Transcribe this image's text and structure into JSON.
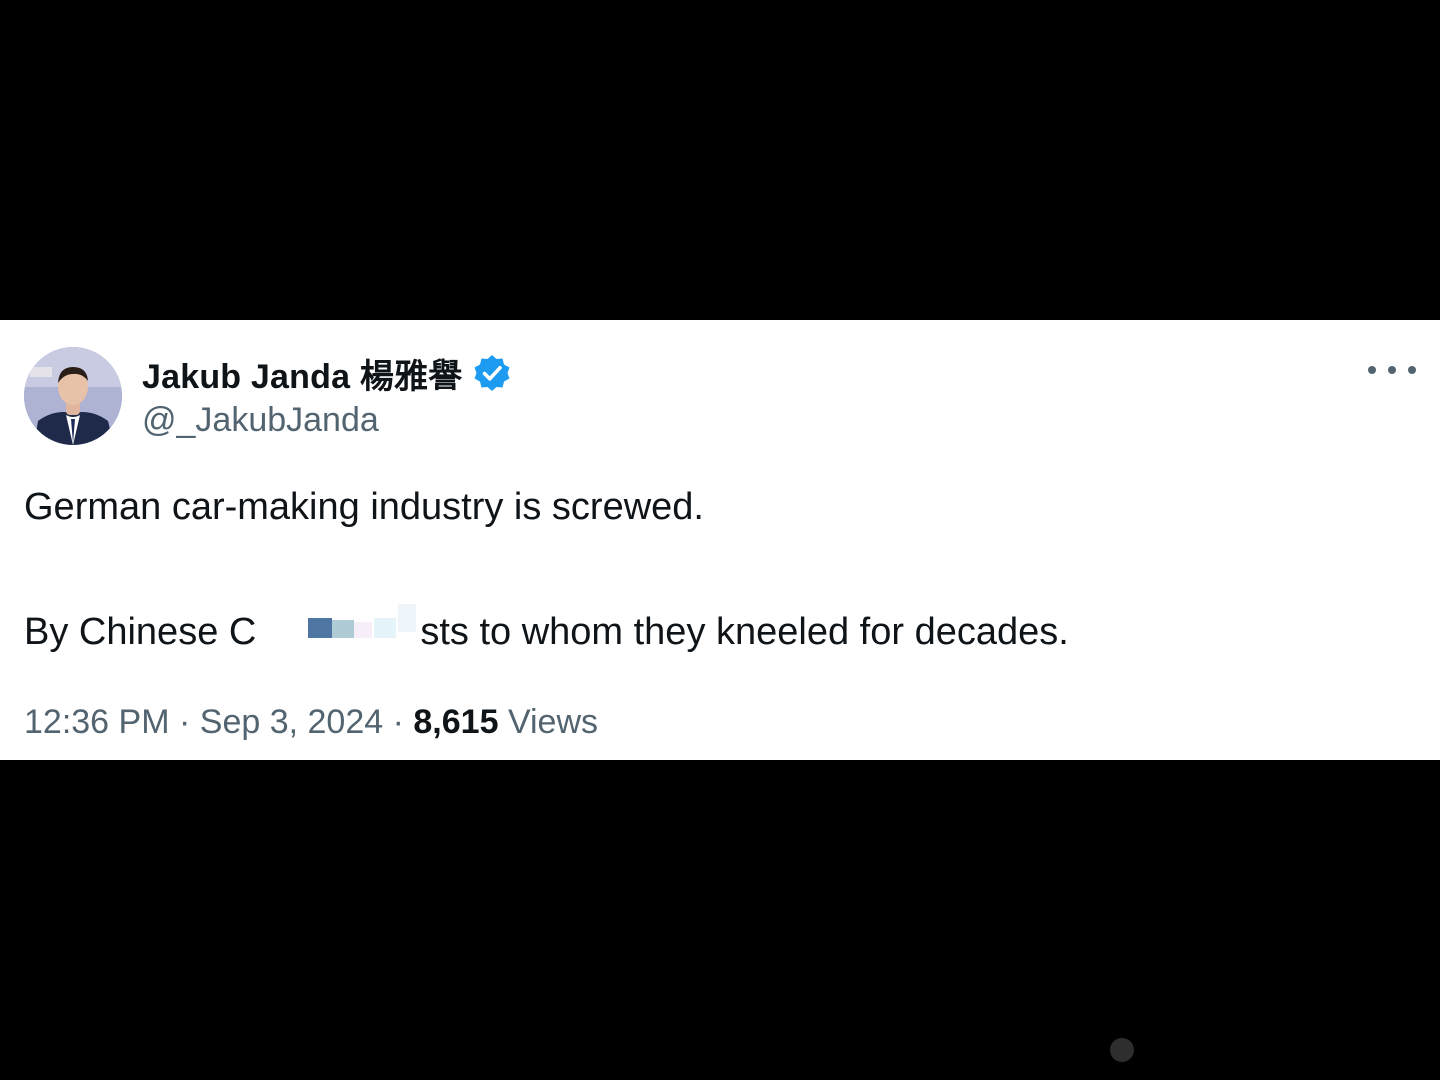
{
  "tweet": {
    "display_name": "Jakub Janda 楊雅譽",
    "handle": "@_JakubJanda",
    "text_line1": "German car-making industry is screwed.",
    "text_line2_start": "By Chinese C",
    "text_line2_end": "sts to whom they kneeled for decades.",
    "time": "12:36 PM",
    "separator": "·",
    "date": "Sep 3, 2024",
    "views_count": "8,615",
    "views_label": "Views"
  },
  "icons": {
    "verified": "verified-badge-icon",
    "more": "more-options-icon",
    "avatar": "profile-avatar"
  },
  "colors": {
    "background": "#000000",
    "card": "#ffffff",
    "primary_text": "#0f1419",
    "secondary_text": "#536471",
    "verified_blue": "#1d9bf0"
  }
}
